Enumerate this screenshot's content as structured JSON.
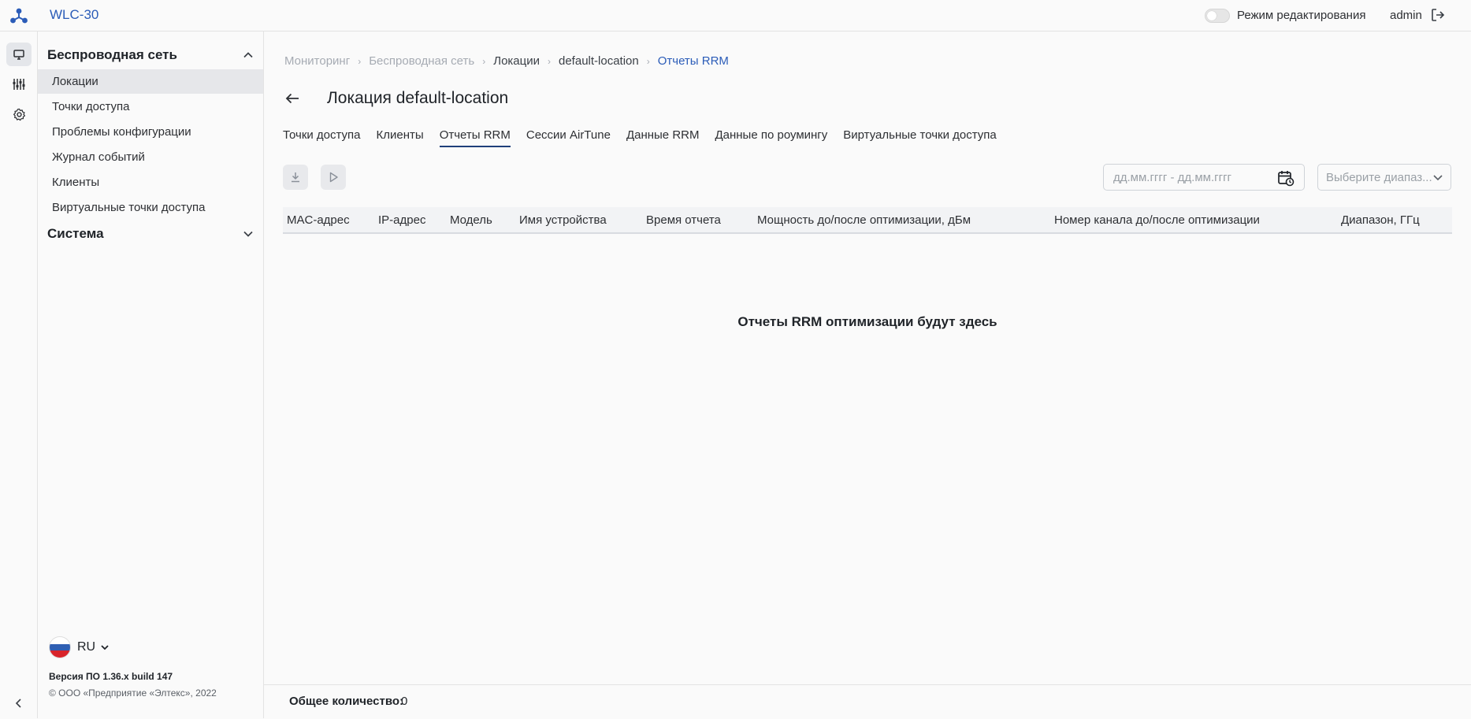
{
  "app": {
    "title": "WLC-30"
  },
  "header": {
    "edit_mode_label": "Режим редактирования",
    "user": "admin"
  },
  "sidebar": {
    "wireless_section": "Беспроводная сеть",
    "items": [
      {
        "label": "Локации"
      },
      {
        "label": "Точки доступа"
      },
      {
        "label": "Проблемы конфигурации"
      },
      {
        "label": "Журнал событий"
      },
      {
        "label": "Клиенты"
      },
      {
        "label": "Виртуальные точки доступа"
      }
    ],
    "system_section": "Система",
    "language": "RU",
    "version": "Версия ПО 1.36.x build 147",
    "copyright": "© ООО «Предприятие «Элтекс», 2022"
  },
  "breadcrumb": [
    "Мониторинг",
    "Беспроводная сеть",
    "Локации",
    "default-location",
    "Отчеты RRM"
  ],
  "page": {
    "title": "Локация default-location"
  },
  "tabs": [
    "Точки доступа",
    "Клиенты",
    "Отчеты RRM",
    "Сессии AirTune",
    "Данные RRM",
    "Данные по роумингу",
    "Виртуальные точки доступа"
  ],
  "active_tab": "Отчеты RRM",
  "filters": {
    "date_placeholder": "дд.мм.гггг - дд.мм.гггг",
    "range_placeholder": "Выберите диапаз..."
  },
  "table": {
    "columns": [
      "MAC-адрес",
      "IP-адрес",
      "Модель",
      "Имя устройства",
      "Время отчета",
      "Мощность до/после оптимизации, дБм",
      "Номер канала до/после оптимизации",
      "Диапазон, ГГц"
    ],
    "empty_message": "Отчеты RRM оптимизации будут здесь"
  },
  "footer": {
    "total_label": "Общее количество:",
    "total_value": "0"
  },
  "colors": {
    "accent": "#2b5cb8",
    "active_tab_underline": "#1f3f7a",
    "flag": [
      "#ffffff",
      "#2f5fb3",
      "#d8232a"
    ]
  }
}
